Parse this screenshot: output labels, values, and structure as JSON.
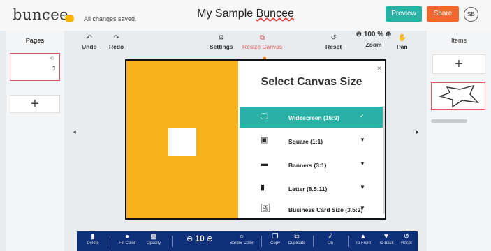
{
  "header": {
    "logo": "buncee",
    "saved_status": "All changes saved.",
    "title_main": "My Sample ",
    "title_underlined": "Buncee",
    "preview_label": "Preview",
    "share_label": "Share",
    "avatar_text": "SB"
  },
  "left_panel": {
    "label": "Pages",
    "page_number": "1",
    "add_symbol": "+"
  },
  "right_panel": {
    "label": "Items",
    "add_symbol": "+"
  },
  "toolbar": {
    "undo": "Undo",
    "redo": "Redo",
    "settings": "Settings",
    "resize_canvas": "Resize Canvas",
    "reset": "Reset",
    "zoom_value": "100 %",
    "zoom_label": "Zoom",
    "pan": "Pan"
  },
  "modal": {
    "title": "Select Canvas Size",
    "close": "×",
    "options": [
      {
        "label": "Widescreen (16:9)",
        "icon": "monitor-icon",
        "selected": true
      },
      {
        "label": "Square (1:1)",
        "icon": "square-icon",
        "selected": false
      },
      {
        "label": "Banners (3:1)",
        "icon": "banner-icon",
        "selected": false
      },
      {
        "label": "Letter (8.5:11)",
        "icon": "document-icon",
        "selected": false
      },
      {
        "label": "Business Card Size (3.5:2)",
        "icon": "card-icon",
        "selected": false
      }
    ]
  },
  "bottom_bar": {
    "delete": "Delete",
    "fill_color": "Fill Color",
    "opacity": "Opacity",
    "stroke_value": "10",
    "border_color": "Border Color",
    "copy": "Copy",
    "duplicate": "Duplicate",
    "animate": "Lin",
    "to_front": "To Front",
    "to_back": "To Back",
    "reset": "Reset"
  },
  "colors": {
    "accent_teal": "#2ab1a6",
    "share_orange": "#f2672e",
    "canvas_yellow": "#f7b21c",
    "selection_red": "#e0585b",
    "bottom_bar_navy": "#0f2f78"
  }
}
